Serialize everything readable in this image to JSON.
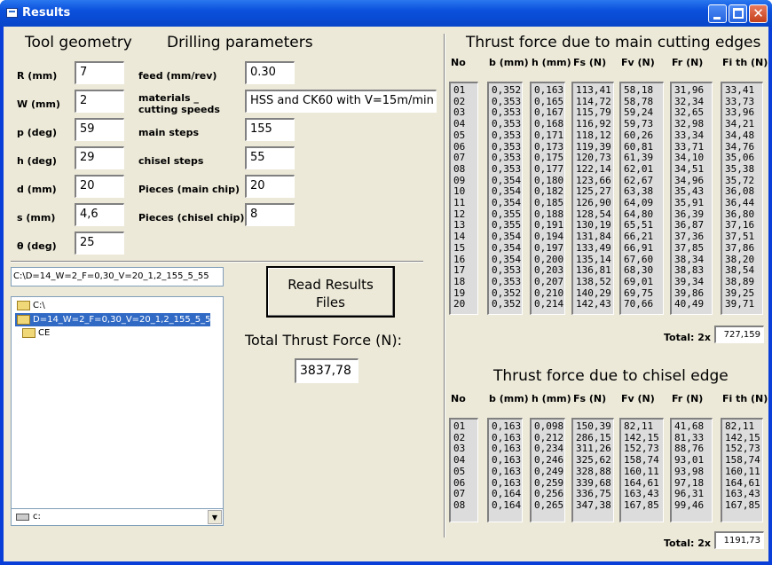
{
  "window": {
    "title": "Results"
  },
  "left": {
    "geometry_header": "Tool geometry",
    "drilling_header": "Drilling parameters",
    "geometry": [
      {
        "label": "R (mm)",
        "value": "7"
      },
      {
        "label": "W (mm)",
        "value": "2"
      },
      {
        "label": "p (deg)",
        "value": "59"
      },
      {
        "label": "h (deg)",
        "value": "29"
      },
      {
        "label": "d (mm)",
        "value": "20"
      },
      {
        "label": "s (mm)",
        "value": "4,6"
      },
      {
        "label": "θ (deg)",
        "value": "25"
      }
    ],
    "drilling": [
      {
        "label": "feed (mm/rev)",
        "value": "0.30"
      },
      {
        "label": "materials _\ncutting speeds",
        "value": "HSS and CK60 with V=15m/min"
      },
      {
        "label": "main steps",
        "value": "155"
      },
      {
        "label": "chisel steps",
        "value": "55"
      },
      {
        "label": "Pieces (main chip)",
        "value": "20"
      },
      {
        "label": "Pieces (chisel chip)",
        "value": "8"
      }
    ],
    "path": "C:\\D=14_W=2_F=0,30_V=20_1,2_155_5_55",
    "dirs": [
      "C:\\",
      "D=14_W=2_F=0,30_V=20_1,2_155_5_55",
      "CE"
    ],
    "drive": "c:",
    "read_button": "Read Results\nFiles",
    "total_label": "Total Thrust Force (N):",
    "total_value": "3837,78"
  },
  "main_table": {
    "title": "Thrust force due to main cutting edges",
    "headers": [
      "No",
      "b (mm)",
      "h (mm)",
      "Fs (N)",
      "Fv (N)",
      "Fr (N)",
      "Fi th (N)"
    ],
    "columns": [
      [
        "01",
        "02",
        "03",
        "04",
        "05",
        "06",
        "07",
        "08",
        "09",
        "10",
        "11",
        "12",
        "13",
        "14",
        "15",
        "16",
        "17",
        "18",
        "19",
        "20"
      ],
      [
        "0,352",
        "0,353",
        "0,353",
        "0,353",
        "0,353",
        "0,353",
        "0,353",
        "0,353",
        "0,354",
        "0,354",
        "0,354",
        "0,355",
        "0,355",
        "0,354",
        "0,354",
        "0,354",
        "0,353",
        "0,353",
        "0,352",
        "0,352"
      ],
      [
        "0,163",
        "0,165",
        "0,167",
        "0,168",
        "0,171",
        "0,173",
        "0,175",
        "0,177",
        "0,180",
        "0,182",
        "0,185",
        "0,188",
        "0,191",
        "0,194",
        "0,197",
        "0,200",
        "0,203",
        "0,207",
        "0,210",
        "0,214"
      ],
      [
        "113,41",
        "114,72",
        "115,79",
        "116,92",
        "118,12",
        "119,39",
        "120,73",
        "122,14",
        "123,66",
        "125,27",
        "126,90",
        "128,54",
        "130,19",
        "131,84",
        "133,49",
        "135,14",
        "136,81",
        "138,52",
        "140,29",
        "142,43"
      ],
      [
        "58,18",
        "58,78",
        "59,24",
        "59,73",
        "60,26",
        "60,81",
        "61,39",
        "62,01",
        "62,67",
        "63,38",
        "64,09",
        "64,80",
        "65,51",
        "66,21",
        "66,91",
        "67,60",
        "68,30",
        "69,01",
        "69,75",
        "70,66"
      ],
      [
        "31,96",
        "32,34",
        "32,65",
        "32,98",
        "33,34",
        "33,71",
        "34,10",
        "34,51",
        "34,96",
        "35,43",
        "35,91",
        "36,39",
        "36,87",
        "37,36",
        "37,85",
        "38,34",
        "38,83",
        "39,34",
        "39,86",
        "40,49"
      ],
      [
        "33,41",
        "33,73",
        "33,96",
        "34,21",
        "34,48",
        "34,76",
        "35,06",
        "35,38",
        "35,72",
        "36,08",
        "36,44",
        "36,80",
        "37,16",
        "37,51",
        "37,86",
        "38,20",
        "38,54",
        "38,89",
        "39,25",
        "39,71"
      ]
    ],
    "total_label": "Total: 2x",
    "total_value": "727,159"
  },
  "chisel_table": {
    "title": "Thrust force due to chisel edge",
    "headers": [
      "No",
      "b (mm)",
      "h (mm)",
      "Fs (N)",
      "Fv (N)",
      "Fr (N)",
      "Fi th (N)"
    ],
    "columns": [
      [
        "01",
        "02",
        "03",
        "04",
        "05",
        "06",
        "07",
        "08"
      ],
      [
        "0,163",
        "0,163",
        "0,163",
        "0,163",
        "0,163",
        "0,163",
        "0,164",
        "0,164"
      ],
      [
        "0,098",
        "0,212",
        "0,234",
        "0,246",
        "0,249",
        "0,259",
        "0,256",
        "0,265"
      ],
      [
        "150,39",
        "286,15",
        "311,26",
        "325,62",
        "328,88",
        "339,68",
        "336,75",
        "347,38"
      ],
      [
        "82,11",
        "142,15",
        "152,73",
        "158,74",
        "160,11",
        "164,61",
        "163,43",
        "167,85"
      ],
      [
        "41,68",
        "81,33",
        "88,76",
        "93,01",
        "93,98",
        "97,18",
        "96,31",
        "99,46"
      ],
      [
        "82,11",
        "142,15",
        "152,73",
        "158,74",
        "160,11",
        "164,61",
        "163,43",
        "167,85"
      ]
    ],
    "total_label": "Total: 2x",
    "total_value": "1191,73"
  }
}
